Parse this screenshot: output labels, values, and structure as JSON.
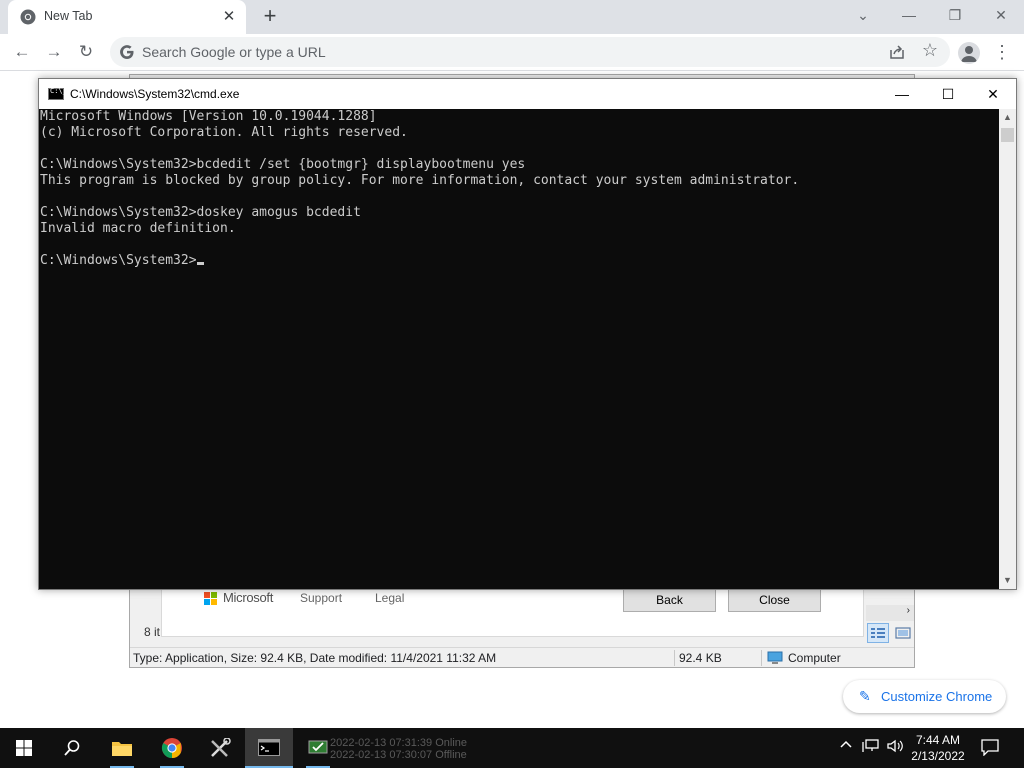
{
  "chrome": {
    "tab_title": "New Tab",
    "tab_close": "✕",
    "new_tab": "+",
    "omnibox_placeholder": "Search Google or type a URL",
    "back": "←",
    "forward": "→",
    "reload": "↻",
    "star": "☆",
    "menu": "⋮",
    "win_min": "—",
    "win_restore": "❐",
    "win_close": "✕",
    "win_dropdown": "⌄"
  },
  "explorer": {
    "brand": "Microsoft",
    "support": "Support",
    "legal": "Legal",
    "back_button": "Back",
    "close_button": "Close",
    "items_count": "8 it",
    "status_type": "Type: Application, Size: 92.4 KB, Date modified: 11/4/2021 11:32 AM",
    "status_size": "92.4 KB",
    "status_location": "Computer",
    "scroll_right": "›"
  },
  "cmd": {
    "title": "C:\\Windows\\System32\\cmd.exe",
    "icon_text": "C:\\_",
    "minimize": "—",
    "maximize": "☐",
    "close": "✕",
    "lines": [
      "Microsoft Windows [Version 10.0.19044.1288]",
      "(c) Microsoft Corporation. All rights reserved.",
      "",
      "C:\\Windows\\System32>bcdedit /set {bootmgr} displaybootmenu yes",
      "This program is blocked by group policy. For more information, contact your system administrator.",
      "",
      "C:\\Windows\\System32>doskey amogus bcdedit",
      "Invalid macro definition.",
      "",
      "C:\\Windows\\System32>"
    ],
    "scroll_up": "▲",
    "scroll_down": "▼"
  },
  "customize": {
    "label": "Customize Chrome",
    "icon": "✎"
  },
  "taskbar": {
    "notif_line1": "2022-02-13 07:31:39 Online",
    "notif_line2": "2022-02-13 07:30:07 Offline",
    "time": "7:44 AM",
    "date": "2/13/2022",
    "tray_chevron": "^",
    "tray_volume": "🔈"
  }
}
